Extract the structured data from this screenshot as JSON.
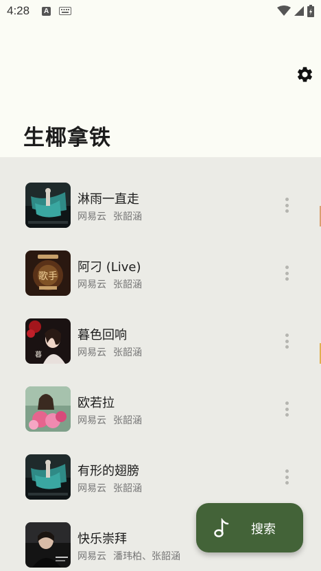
{
  "status_bar": {
    "time": "4:28",
    "icons": [
      "a-notification-icon",
      "keyboard-icon",
      "wifi-icon",
      "signal-icon",
      "battery-icon"
    ]
  },
  "header": {
    "title": "生椰拿铁",
    "settings_icon": "gear-icon"
  },
  "songs": [
    {
      "title": "淋雨一直走",
      "source": "网易云",
      "artist": "张韶涵",
      "cover_palette": "teal-dancer"
    },
    {
      "title": "阿刁 (Live)",
      "source": "网易云",
      "artist": "张韶涵",
      "cover_palette": "singer-show"
    },
    {
      "title": "暮色回响",
      "source": "网易云",
      "artist": "张韶涵",
      "cover_palette": "red-rose"
    },
    {
      "title": "欧若拉",
      "source": "网易云",
      "artist": "张韶涵",
      "cover_palette": "pink-flowers"
    },
    {
      "title": "有形的翅膀",
      "source": "网易云",
      "artist": "张韶涵",
      "cover_palette": "teal-dancer"
    },
    {
      "title": "快乐崇拜",
      "source": "网易云",
      "artist": "潘玮柏、张韶涵",
      "cover_palette": "dark-portrait"
    }
  ],
  "fab": {
    "label": "搜索",
    "icon": "music-note-icon"
  },
  "colors": {
    "header_bg": "#fbfcf5",
    "list_bg": "#ebebe6",
    "fab_bg": "#436338"
  }
}
